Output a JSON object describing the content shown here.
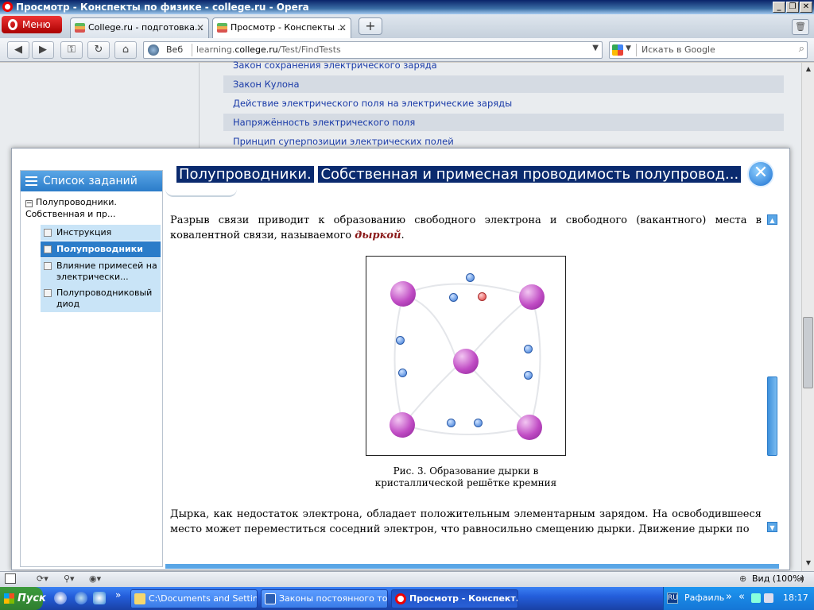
{
  "window": {
    "title": "Просмотр - Конспекты по физике - college.ru - Opera",
    "controls": [
      "_",
      "❐",
      "✕"
    ]
  },
  "tabs": {
    "menu_label": "Меню",
    "items": [
      {
        "label": "College.ru - подготовка..."
      },
      {
        "label": "Просмотр - Конспекты ..."
      }
    ],
    "new_tab": "+"
  },
  "nav": {
    "web_label": "Веб",
    "url_prefix": "learning.",
    "url_domain": "college.ru",
    "url_path": "/Test/FindTests",
    "search_placeholder": "Искать в Google"
  },
  "background_links": [
    "Закон сохранения электрического заряда",
    "Закон Кулона",
    "Действие электрического поля на электрические заряды",
    "Напряжённость электрического поля",
    "Принцип суперпозиции электрических полей"
  ],
  "modal": {
    "title_part1": "Полупроводники.",
    "title_part2": "Собственная и примесная проводимость полупровод...",
    "close": "✕",
    "sidebar": {
      "header": "Список заданий",
      "root": "Полупроводники. Собственная и пр...",
      "items": [
        {
          "label": "Инструкция"
        },
        {
          "label": "Полупроводники"
        },
        {
          "label": "Влияние примесей на электрически..."
        },
        {
          "label": "Полупроводниковый диод"
        }
      ]
    },
    "para1_text": "Разрыв связи приводит к образованию свободного электрона и свободного (вакантного) места в ковалентной связи, называемого ",
    "para1_em": "дыркой",
    "para1_end": ".",
    "caption": "Рис. 3. Образование дырки в кристаллической решётке кремния",
    "para2": "Дырка, как недостаток электрона, обладает положительным элементарным зарядом. На освободившееся место может переместиться соседний электрон, что равносильно смещению дырки. Движение дырки по"
  },
  "status": {
    "zoom_label": "Вид (100%)"
  },
  "taskbar": {
    "start": "Пуск",
    "tasks": [
      {
        "label": "C:\\Documents and Settin..."
      },
      {
        "label": "Законы постоянного то..."
      },
      {
        "label": "Просмотр - Конспект..."
      }
    ],
    "lang": "RU",
    "user": "Рафаиль",
    "clock": "18:17"
  },
  "colors": {
    "accent": "#2b7cc9",
    "title_bg": "#0a2a6e",
    "em_text": "#8b1a1a"
  }
}
